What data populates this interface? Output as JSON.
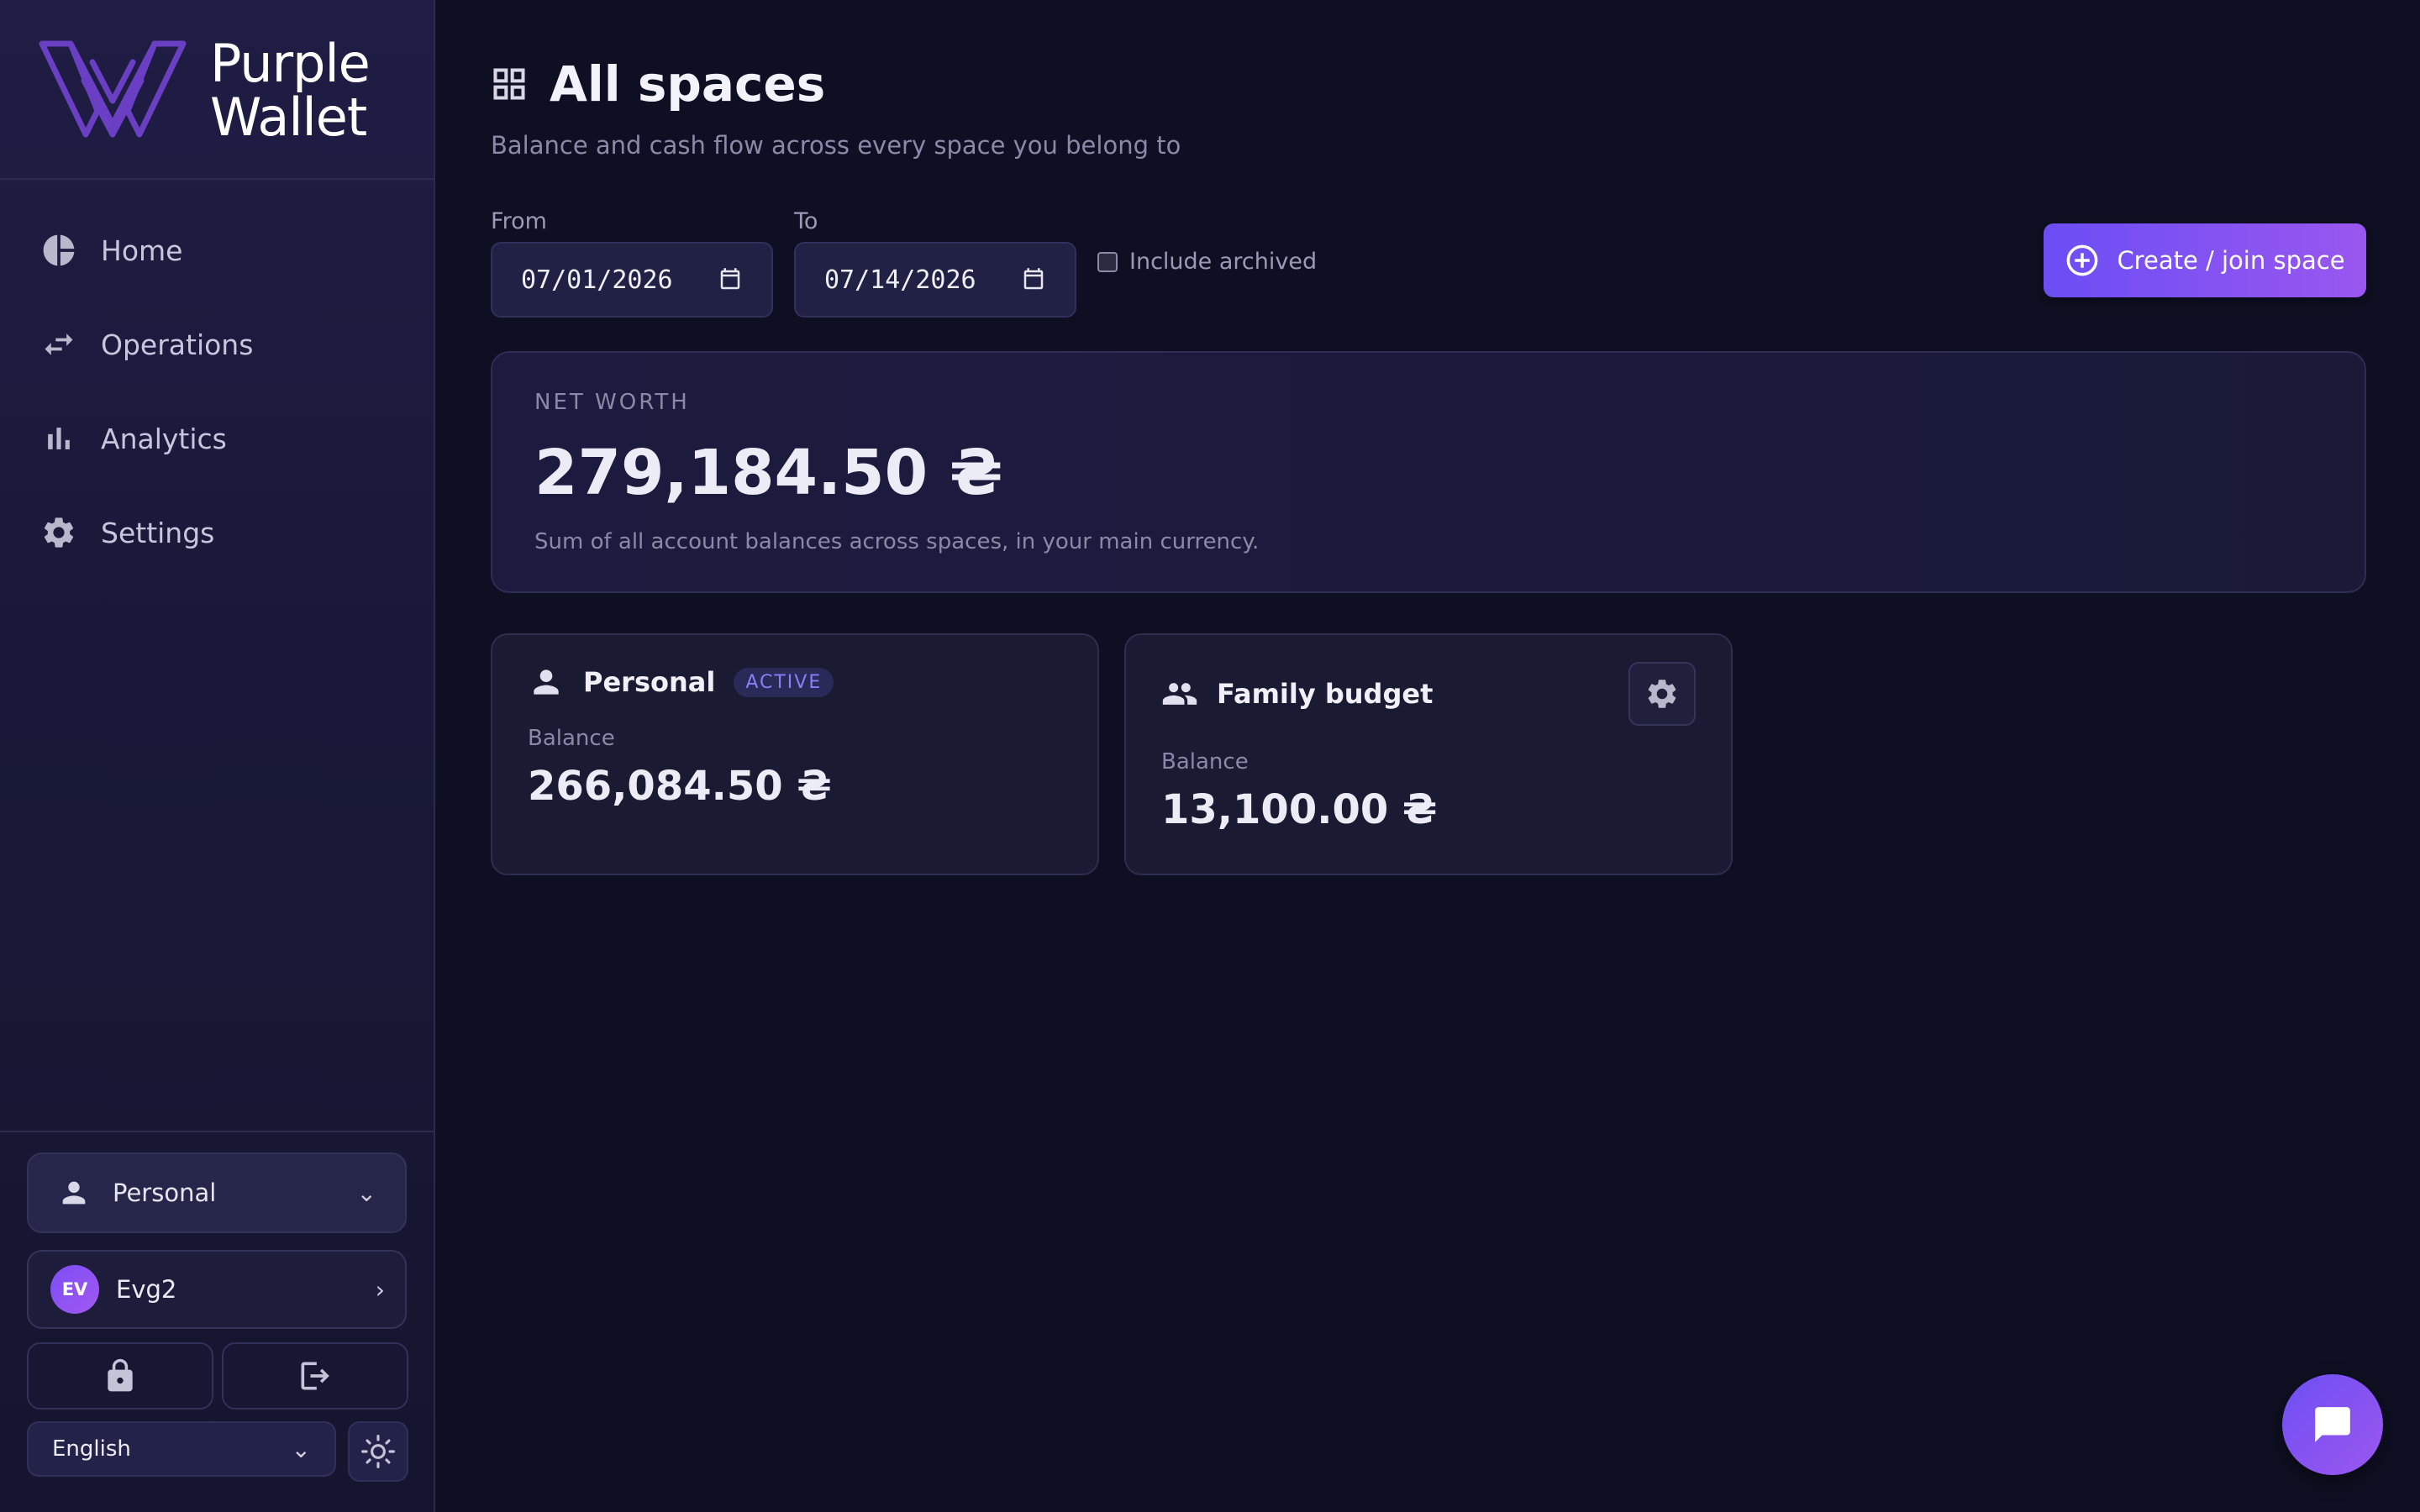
{
  "app": {
    "name_line1": "Purple",
    "name_line2": "Wallet",
    "accent": "#7b4df5",
    "accent_end": "#9c57ef",
    "background": "#0e0f22"
  },
  "sidebar": {
    "items": [
      {
        "label": "Home",
        "icon": "pie-chart-icon"
      },
      {
        "label": "Operations",
        "icon": "swap-arrows-icon"
      },
      {
        "label": "Analytics",
        "icon": "bar-chart-icon"
      },
      {
        "label": "Settings",
        "icon": "gear-icon"
      }
    ],
    "space_select": {
      "label": "Personal",
      "icon": "person-icon"
    },
    "user": {
      "initials": "EV",
      "name": "Evg2"
    },
    "actions": [
      {
        "icon": "lock-icon"
      },
      {
        "icon": "logout-icon"
      }
    ],
    "language": "English",
    "theme_icon": "sun-icon"
  },
  "header": {
    "title": "All spaces",
    "title_icon": "grid-icon",
    "subtitle": "Balance and cash flow across every space you belong to"
  },
  "filters": {
    "from_label": "From",
    "from_value": "07/01/2026",
    "to_label": "To",
    "to_value": "07/14/2026",
    "include_archived_label": "Include archived",
    "include_archived_checked": false
  },
  "create_button": {
    "label": "Create / join space",
    "icon": "plus-circle-icon"
  },
  "net_worth": {
    "label": "NET WORTH",
    "value": "279,184.50 ₴",
    "note": "Sum of all account balances across spaces, in your main currency."
  },
  "spaces": [
    {
      "name": "Personal",
      "badge": "ACTIVE",
      "icon": "person-icon",
      "balance_label": "Balance",
      "balance": "266,084.50 ₴"
    },
    {
      "name": "Family budget",
      "icon": "group-icon",
      "balance_label": "Balance",
      "balance": "13,100.00 ₴"
    }
  ],
  "chat_button": {
    "icon": "chat-bubble-icon"
  }
}
